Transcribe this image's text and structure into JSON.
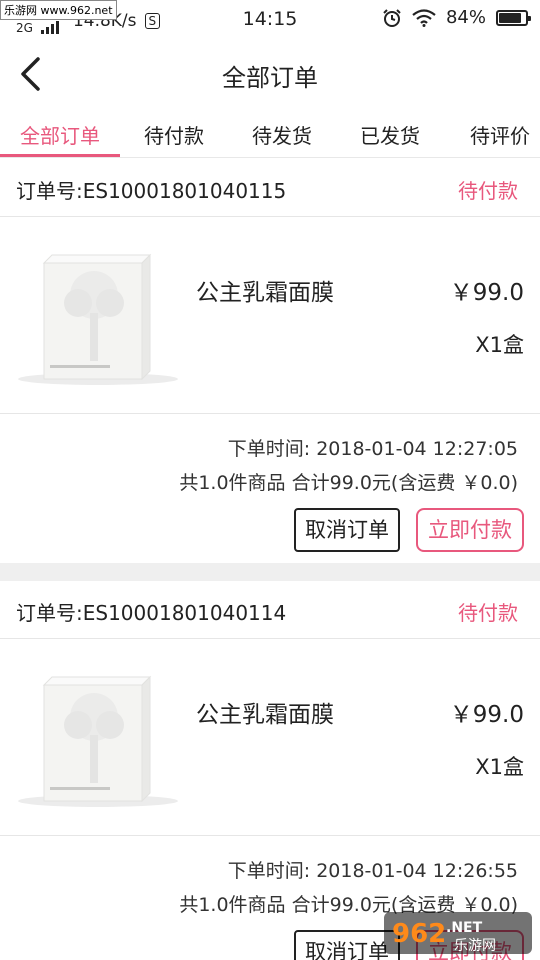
{
  "status_bar": {
    "site_badge": "乐游网 www.962.net",
    "network": "2G",
    "speed": "14.8K/s",
    "s_badge": "S",
    "time": "14:15",
    "battery": "84%",
    "battery_level": 0.84
  },
  "nav": {
    "title": "全部订单"
  },
  "tabs": [
    {
      "label": "全部订单",
      "active": true
    },
    {
      "label": "待付款",
      "active": false
    },
    {
      "label": "待发货",
      "active": false
    },
    {
      "label": "已发货",
      "active": false
    },
    {
      "label": "待评价",
      "active": false
    }
  ],
  "orders": [
    {
      "order_no": "订单号:ES10001801040115",
      "status": "待付款",
      "product_name": "公主乳霜面膜",
      "price": "￥99.0",
      "quantity": "X1盒",
      "time": "下单时间: 2018-01-04 12:27:05",
      "total": "共1.0件商品  合计99.0元(含运费 ￥0.0)",
      "cancel_label": "取消订单",
      "pay_label": "立即付款"
    },
    {
      "order_no": "订单号:ES10001801040114",
      "status": "待付款",
      "product_name": "公主乳霜面膜",
      "price": "￥99.0",
      "quantity": "X1盒",
      "time": "下单时间: 2018-01-04 12:26:55",
      "total": "共1.0件商品  合计99.0元(含运费 ￥0.0)",
      "cancel_label": "取消订单",
      "pay_label": "立即付款"
    }
  ],
  "watermark": {
    "brand": "962",
    "suffix": ".NET",
    "sub": "乐游网"
  },
  "colors": {
    "accent": "#e8587d",
    "text": "#222222",
    "divider": "#efefef"
  }
}
